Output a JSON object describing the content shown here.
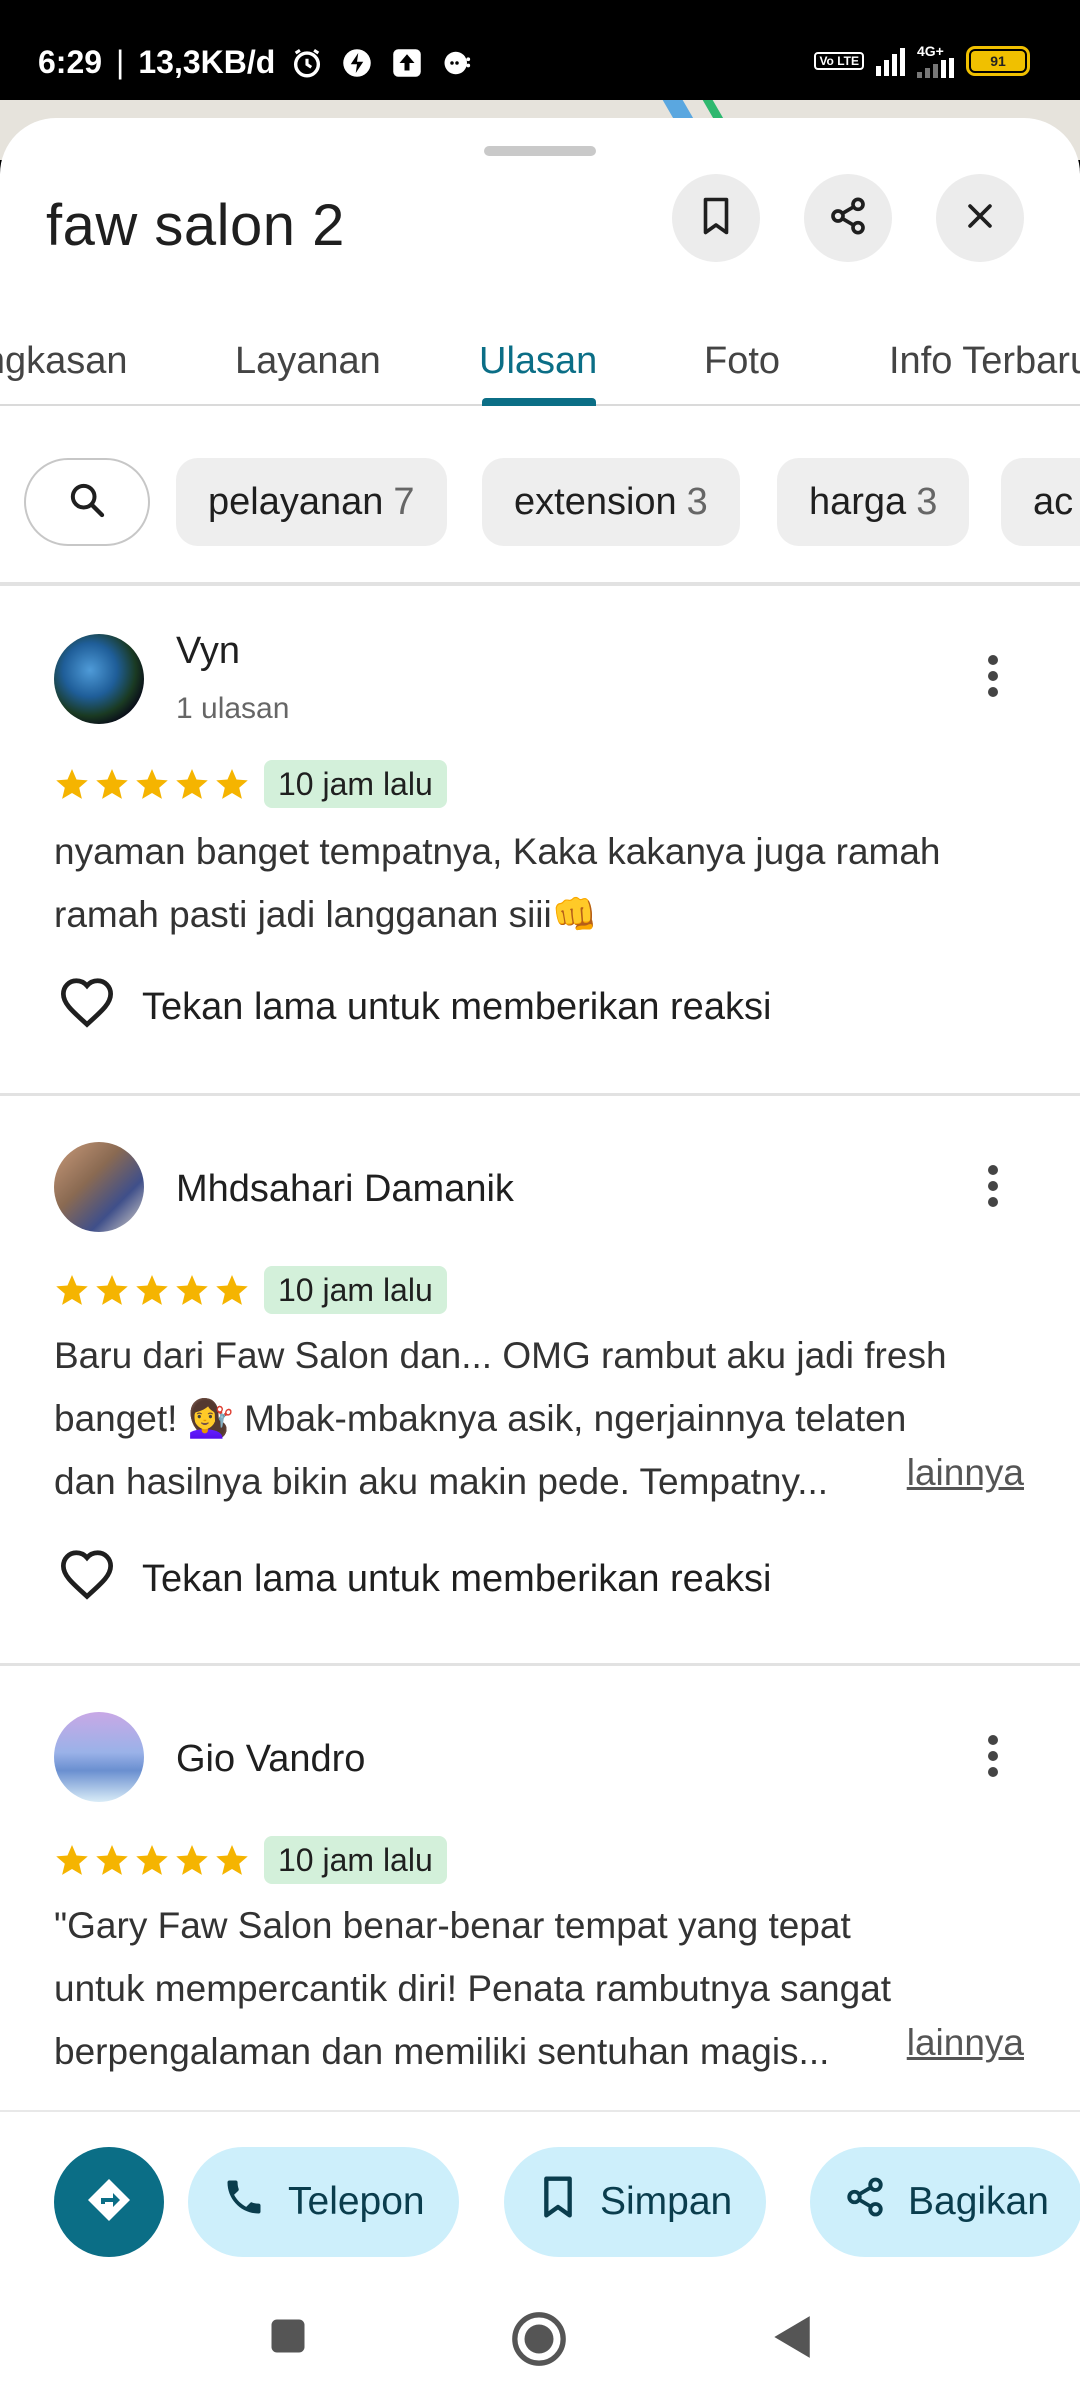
{
  "status_bar": {
    "time": "6:29",
    "speed": "13,3KB/d",
    "volte": "Vo LTE",
    "network": "4G+",
    "battery": "91"
  },
  "place": {
    "title": "faw salon 2"
  },
  "tabs": [
    {
      "label": "Ringkasan"
    },
    {
      "label": "Layanan"
    },
    {
      "label": "Ulasan"
    },
    {
      "label": "Foto"
    },
    {
      "label": "Info Terbaru"
    }
  ],
  "active_tab": "Ulasan",
  "filter_chips": [
    {
      "label": "pelayanan",
      "count": "7"
    },
    {
      "label": "extension",
      "count": "3"
    },
    {
      "label": "harga",
      "count": "3"
    },
    {
      "label": "ac",
      "count": ""
    }
  ],
  "reviews": [
    {
      "name": "Vyn",
      "subtitle": "1 ulasan",
      "rating": 5,
      "time_ago": "10 jam lalu",
      "text_line1": "nyaman banget tempatnya, Kaka kakanya juga ramah",
      "text_line2": "ramah pasti jadi langganan siii👊",
      "reaction_label": "Tekan lama untuk memberikan reaksi"
    },
    {
      "name": "Mhdsahari Damanik",
      "rating": 5,
      "time_ago": "10 jam lalu",
      "text_line1": "Baru dari Faw Salon dan... OMG rambut aku jadi fresh",
      "text_line2": "banget! 💇‍♀️ Mbak-mbaknya asik, ngerjainnya telaten",
      "text_line3": "dan hasilnya bikin aku makin pede. Tempatny...",
      "more_label": "lainnya",
      "reaction_label": "Tekan lama untuk memberikan reaksi"
    },
    {
      "name": "Gio Vandro",
      "rating": 5,
      "time_ago": "10 jam lalu",
      "text_line1": "\"Gary Faw Salon benar-benar tempat yang tepat",
      "text_line2": "untuk mempercantik diri! Penata rambutnya sangat",
      "text_line3": "berpengalaman dan memiliki sentuhan magis...",
      "more_label": "lainnya"
    }
  ],
  "actions": {
    "call_label": "Telepon",
    "save_label": "Simpan",
    "share_label": "Bagikan"
  },
  "colors": {
    "accent": "#0b6e86",
    "star": "#f5b400",
    "time_badge": "#d3f0da",
    "action_pill": "#cdeffb"
  }
}
